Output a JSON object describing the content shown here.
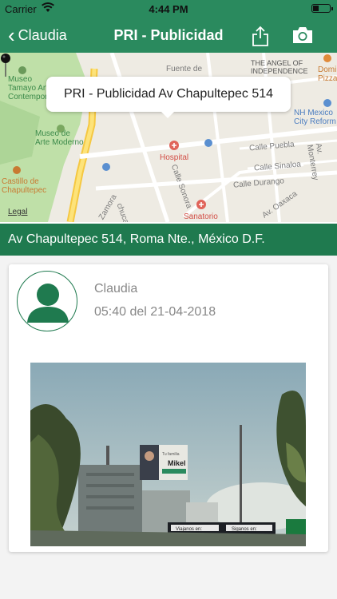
{
  "status_bar": {
    "carrier": "Carrier",
    "time": "4:44 PM"
  },
  "nav": {
    "back_label": "Claudia",
    "title": "PRI - Publicidad",
    "share_icon": "share-icon",
    "camera_icon": "camera-icon"
  },
  "map": {
    "callout": "PRI - Publicidad Av Chapultepec 514",
    "legal": "Legal",
    "labels": {
      "museo_tamayo": "Museo\nTamayo Arte\nContemporáneo",
      "museo_arte": "Museo de\nArte Moderno",
      "castillo": "Castillo de\nChapultepec",
      "fuente": "Fuente de",
      "angel": "THE ANGEL OF\nINDEPENDENCE",
      "domino": "Domino\nPizza",
      "nh": "NH Mexico\nCity Reform",
      "hospital": "Hospital",
      "sanatorio": "Sanatorio",
      "calle_puebla": "Calle Puebla",
      "calle_sinaloa": "Calle Sinaloa",
      "calle_durango": "Calle Durango",
      "calle_sonora": "Calle Sonora",
      "av_monterrey": "Av. Monterrey",
      "oaxaca": "Av. Oaxaca",
      "zamora": "Zamora",
      "chucha": "chuca"
    }
  },
  "address": "Av Chapultepec 514, Roma Nte., México D.F.",
  "post": {
    "user": "Claudia",
    "timestamp": "05:40 del 21-04-2018",
    "billboard_text_1": "Tu familia",
    "billboard_text_2": "Mikel",
    "sign_left": "Viajanos en:",
    "sign_right": "Siganos en:"
  },
  "colors": {
    "primary": "#2a8a5e",
    "dark": "#1f7a4f"
  }
}
